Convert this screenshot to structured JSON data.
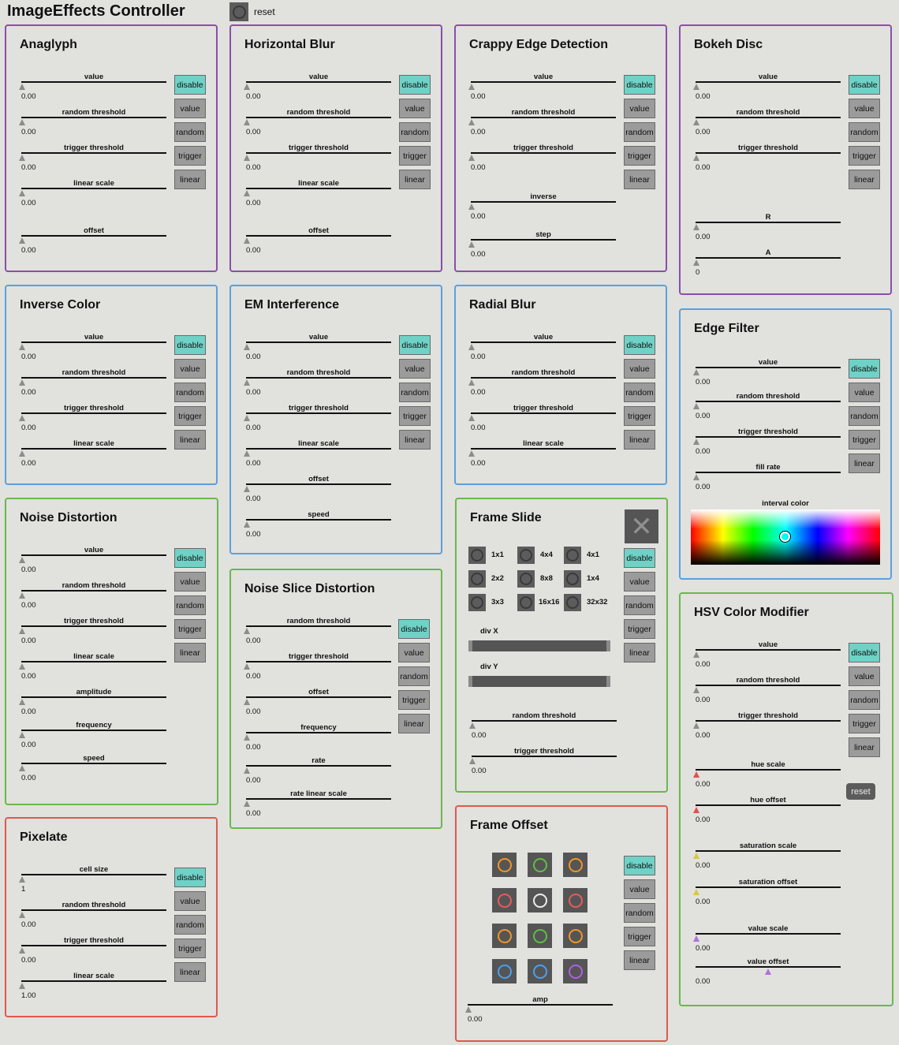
{
  "app_title": "ImageEffects Controller",
  "reset_label": "reset",
  "panels": {
    "anaglyph": {
      "title": "Anaglyph",
      "sliders": [
        {
          "label": "value",
          "value": "0.00"
        },
        {
          "label": "random threshold",
          "value": "0.00"
        },
        {
          "label": "trigger threshold",
          "value": "0.00"
        },
        {
          "label": "linear scale",
          "value": "0.00"
        },
        {
          "label": "offset",
          "value": "0.00"
        }
      ]
    },
    "hblur": {
      "title": "Horizontal Blur",
      "sliders": [
        {
          "label": "value",
          "value": "0.00"
        },
        {
          "label": "random threshold",
          "value": "0.00"
        },
        {
          "label": "trigger threshold",
          "value": "0.00"
        },
        {
          "label": "linear scale",
          "value": "0.00"
        },
        {
          "label": "offset",
          "value": "0.00"
        }
      ]
    },
    "crappy": {
      "title": "Crappy Edge Detection",
      "sliders": [
        {
          "label": "value",
          "value": "0.00"
        },
        {
          "label": "random threshold",
          "value": "0.00"
        },
        {
          "label": "trigger threshold",
          "value": "0.00"
        },
        {
          "label": "inverse",
          "value": "0.00"
        },
        {
          "label": "step",
          "value": "0.00"
        }
      ]
    },
    "bokeh": {
      "title": "Bokeh Disc",
      "sliders": [
        {
          "label": "value",
          "value": "0.00"
        },
        {
          "label": "random threshold",
          "value": "0.00"
        },
        {
          "label": "trigger threshold",
          "value": "0.00"
        },
        {
          "label": "R",
          "value": "0.00"
        },
        {
          "label": "A",
          "value": "0"
        }
      ]
    },
    "inverse": {
      "title": "Inverse Color",
      "sliders": [
        {
          "label": "value",
          "value": "0.00"
        },
        {
          "label": "random threshold",
          "value": "0.00"
        },
        {
          "label": "trigger threshold",
          "value": "0.00"
        },
        {
          "label": "linear scale",
          "value": "0.00"
        }
      ]
    },
    "em": {
      "title": "EM Interference",
      "sliders": [
        {
          "label": "value",
          "value": "0.00"
        },
        {
          "label": "random threshold",
          "value": "0.00"
        },
        {
          "label": "trigger threshold",
          "value": "0.00"
        },
        {
          "label": "linear scale",
          "value": "0.00"
        },
        {
          "label": "offset",
          "value": "0.00"
        },
        {
          "label": "speed",
          "value": "0.00"
        }
      ]
    },
    "radial": {
      "title": "Radial Blur",
      "sliders": [
        {
          "label": "value",
          "value": "0.00"
        },
        {
          "label": "random threshold",
          "value": "0.00"
        },
        {
          "label": "trigger threshold",
          "value": "0.00"
        },
        {
          "label": "linear scale",
          "value": "0.00"
        }
      ]
    },
    "edge": {
      "title": "Edge Filter",
      "sliders": [
        {
          "label": "value",
          "value": "0.00"
        },
        {
          "label": "random threshold",
          "value": "0.00"
        },
        {
          "label": "trigger threshold",
          "value": "0.00"
        },
        {
          "label": "fill rate",
          "value": "0.00"
        }
      ],
      "picker_label": "interval color"
    },
    "noise": {
      "title": "Noise Distortion",
      "sliders": [
        {
          "label": "value",
          "value": "0.00"
        },
        {
          "label": "random threshold",
          "value": "0.00"
        },
        {
          "label": "trigger threshold",
          "value": "0.00"
        },
        {
          "label": "linear scale",
          "value": "0.00"
        },
        {
          "label": "amplitude",
          "value": "0.00"
        },
        {
          "label": "frequency",
          "value": "0.00"
        },
        {
          "label": "speed",
          "value": "0.00"
        }
      ]
    },
    "nslice": {
      "title": "Noise Slice Distortion",
      "sliders": [
        {
          "label": "random threshold",
          "value": "0.00"
        },
        {
          "label": "trigger threshold",
          "value": "0.00"
        },
        {
          "label": "offset",
          "value": "0.00"
        },
        {
          "label": "frequency",
          "value": "0.00"
        },
        {
          "label": "rate",
          "value": "0.00"
        },
        {
          "label": "rate linear scale",
          "value": "0.00"
        }
      ]
    },
    "fslide": {
      "title": "Frame Slide",
      "grid": [
        "1x1",
        "4x4",
        "4x1",
        "2x2",
        "8x8",
        "1x4",
        "3x3",
        "16x16",
        "32x32"
      ],
      "div_x": "div X",
      "div_y": "div Y",
      "sliders": [
        {
          "label": "random threshold",
          "value": "0.00"
        },
        {
          "label": "trigger threshold",
          "value": "0.00"
        }
      ]
    },
    "hsv": {
      "title": "HSV Color Modifier",
      "sliders": [
        {
          "label": "value",
          "value": "0.00"
        },
        {
          "label": "random threshold",
          "value": "0.00"
        },
        {
          "label": "trigger threshold",
          "value": "0.00"
        },
        {
          "label": "hue scale",
          "value": "0.00"
        },
        {
          "label": "hue offset",
          "value": "0.00"
        },
        {
          "label": "saturation scale",
          "value": "0.00"
        },
        {
          "label": "saturation offset",
          "value": "0.00"
        },
        {
          "label": "value scale",
          "value": "0.00"
        },
        {
          "label": "value offset",
          "value": "0.00"
        }
      ],
      "reset": "reset"
    },
    "pixelate": {
      "title": "Pixelate",
      "sliders": [
        {
          "label": "cell size",
          "value": "1"
        },
        {
          "label": "random threshold",
          "value": "0.00"
        },
        {
          "label": "trigger threshold",
          "value": "0.00"
        },
        {
          "label": "linear scale",
          "value": "1.00"
        }
      ]
    },
    "foffset": {
      "title": "Frame Offset",
      "ring_colors": [
        "#f0962a",
        "#5ec040",
        "#f0962a",
        "#e85a5a",
        "#ececec",
        "#e85a5a",
        "#f0962a",
        "#5ec040",
        "#f0962a",
        "#4aa0f0",
        "#4aa0f0",
        "#b060e0"
      ],
      "sliders": [
        {
          "label": "amp",
          "value": "0.00"
        }
      ]
    }
  },
  "mode_buttons": {
    "disable": "disable",
    "value": "value",
    "random": "random",
    "trigger": "trigger",
    "linear": "linear"
  },
  "colors": {
    "active_button": "#6fd2c6",
    "button": "#9b9b9b",
    "purple_border": "#8a4fa8",
    "blue_border": "#5aa0dc",
    "green_border": "#6ab84c",
    "red_border": "#dd5a4e"
  }
}
